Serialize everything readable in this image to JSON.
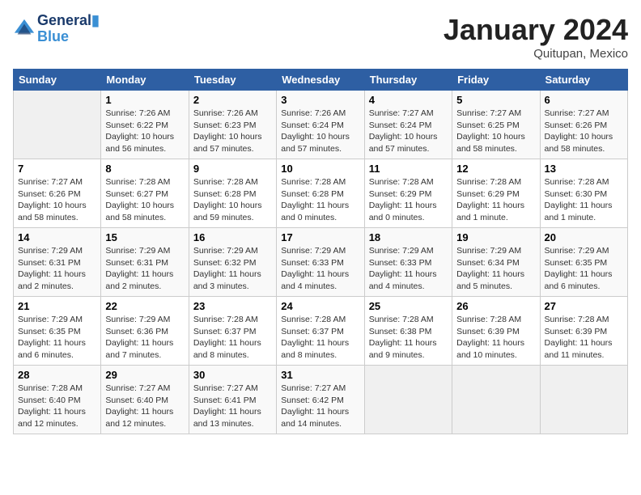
{
  "logo": {
    "line1": "General",
    "line2": "Blue"
  },
  "title": "January 2024",
  "subtitle": "Quitupan, Mexico",
  "days_of_week": [
    "Sunday",
    "Monday",
    "Tuesday",
    "Wednesday",
    "Thursday",
    "Friday",
    "Saturday"
  ],
  "weeks": [
    [
      {
        "num": "",
        "sunrise": "",
        "sunset": "",
        "daylight": ""
      },
      {
        "num": "1",
        "sunrise": "Sunrise: 7:26 AM",
        "sunset": "Sunset: 6:22 PM",
        "daylight": "Daylight: 10 hours and 56 minutes."
      },
      {
        "num": "2",
        "sunrise": "Sunrise: 7:26 AM",
        "sunset": "Sunset: 6:23 PM",
        "daylight": "Daylight: 10 hours and 57 minutes."
      },
      {
        "num": "3",
        "sunrise": "Sunrise: 7:26 AM",
        "sunset": "Sunset: 6:24 PM",
        "daylight": "Daylight: 10 hours and 57 minutes."
      },
      {
        "num": "4",
        "sunrise": "Sunrise: 7:27 AM",
        "sunset": "Sunset: 6:24 PM",
        "daylight": "Daylight: 10 hours and 57 minutes."
      },
      {
        "num": "5",
        "sunrise": "Sunrise: 7:27 AM",
        "sunset": "Sunset: 6:25 PM",
        "daylight": "Daylight: 10 hours and 58 minutes."
      },
      {
        "num": "6",
        "sunrise": "Sunrise: 7:27 AM",
        "sunset": "Sunset: 6:26 PM",
        "daylight": "Daylight: 10 hours and 58 minutes."
      }
    ],
    [
      {
        "num": "7",
        "sunrise": "Sunrise: 7:27 AM",
        "sunset": "Sunset: 6:26 PM",
        "daylight": "Daylight: 10 hours and 58 minutes."
      },
      {
        "num": "8",
        "sunrise": "Sunrise: 7:28 AM",
        "sunset": "Sunset: 6:27 PM",
        "daylight": "Daylight: 10 hours and 58 minutes."
      },
      {
        "num": "9",
        "sunrise": "Sunrise: 7:28 AM",
        "sunset": "Sunset: 6:28 PM",
        "daylight": "Daylight: 10 hours and 59 minutes."
      },
      {
        "num": "10",
        "sunrise": "Sunrise: 7:28 AM",
        "sunset": "Sunset: 6:28 PM",
        "daylight": "Daylight: 11 hours and 0 minutes."
      },
      {
        "num": "11",
        "sunrise": "Sunrise: 7:28 AM",
        "sunset": "Sunset: 6:29 PM",
        "daylight": "Daylight: 11 hours and 0 minutes."
      },
      {
        "num": "12",
        "sunrise": "Sunrise: 7:28 AM",
        "sunset": "Sunset: 6:29 PM",
        "daylight": "Daylight: 11 hours and 1 minute."
      },
      {
        "num": "13",
        "sunrise": "Sunrise: 7:28 AM",
        "sunset": "Sunset: 6:30 PM",
        "daylight": "Daylight: 11 hours and 1 minute."
      }
    ],
    [
      {
        "num": "14",
        "sunrise": "Sunrise: 7:29 AM",
        "sunset": "Sunset: 6:31 PM",
        "daylight": "Daylight: 11 hours and 2 minutes."
      },
      {
        "num": "15",
        "sunrise": "Sunrise: 7:29 AM",
        "sunset": "Sunset: 6:31 PM",
        "daylight": "Daylight: 11 hours and 2 minutes."
      },
      {
        "num": "16",
        "sunrise": "Sunrise: 7:29 AM",
        "sunset": "Sunset: 6:32 PM",
        "daylight": "Daylight: 11 hours and 3 minutes."
      },
      {
        "num": "17",
        "sunrise": "Sunrise: 7:29 AM",
        "sunset": "Sunset: 6:33 PM",
        "daylight": "Daylight: 11 hours and 4 minutes."
      },
      {
        "num": "18",
        "sunrise": "Sunrise: 7:29 AM",
        "sunset": "Sunset: 6:33 PM",
        "daylight": "Daylight: 11 hours and 4 minutes."
      },
      {
        "num": "19",
        "sunrise": "Sunrise: 7:29 AM",
        "sunset": "Sunset: 6:34 PM",
        "daylight": "Daylight: 11 hours and 5 minutes."
      },
      {
        "num": "20",
        "sunrise": "Sunrise: 7:29 AM",
        "sunset": "Sunset: 6:35 PM",
        "daylight": "Daylight: 11 hours and 6 minutes."
      }
    ],
    [
      {
        "num": "21",
        "sunrise": "Sunrise: 7:29 AM",
        "sunset": "Sunset: 6:35 PM",
        "daylight": "Daylight: 11 hours and 6 minutes."
      },
      {
        "num": "22",
        "sunrise": "Sunrise: 7:29 AM",
        "sunset": "Sunset: 6:36 PM",
        "daylight": "Daylight: 11 hours and 7 minutes."
      },
      {
        "num": "23",
        "sunrise": "Sunrise: 7:28 AM",
        "sunset": "Sunset: 6:37 PM",
        "daylight": "Daylight: 11 hours and 8 minutes."
      },
      {
        "num": "24",
        "sunrise": "Sunrise: 7:28 AM",
        "sunset": "Sunset: 6:37 PM",
        "daylight": "Daylight: 11 hours and 8 minutes."
      },
      {
        "num": "25",
        "sunrise": "Sunrise: 7:28 AM",
        "sunset": "Sunset: 6:38 PM",
        "daylight": "Daylight: 11 hours and 9 minutes."
      },
      {
        "num": "26",
        "sunrise": "Sunrise: 7:28 AM",
        "sunset": "Sunset: 6:39 PM",
        "daylight": "Daylight: 11 hours and 10 minutes."
      },
      {
        "num": "27",
        "sunrise": "Sunrise: 7:28 AM",
        "sunset": "Sunset: 6:39 PM",
        "daylight": "Daylight: 11 hours and 11 minutes."
      }
    ],
    [
      {
        "num": "28",
        "sunrise": "Sunrise: 7:28 AM",
        "sunset": "Sunset: 6:40 PM",
        "daylight": "Daylight: 11 hours and 12 minutes."
      },
      {
        "num": "29",
        "sunrise": "Sunrise: 7:27 AM",
        "sunset": "Sunset: 6:40 PM",
        "daylight": "Daylight: 11 hours and 12 minutes."
      },
      {
        "num": "30",
        "sunrise": "Sunrise: 7:27 AM",
        "sunset": "Sunset: 6:41 PM",
        "daylight": "Daylight: 11 hours and 13 minutes."
      },
      {
        "num": "31",
        "sunrise": "Sunrise: 7:27 AM",
        "sunset": "Sunset: 6:42 PM",
        "daylight": "Daylight: 11 hours and 14 minutes."
      },
      {
        "num": "",
        "sunrise": "",
        "sunset": "",
        "daylight": ""
      },
      {
        "num": "",
        "sunrise": "",
        "sunset": "",
        "daylight": ""
      },
      {
        "num": "",
        "sunrise": "",
        "sunset": "",
        "daylight": ""
      }
    ]
  ]
}
